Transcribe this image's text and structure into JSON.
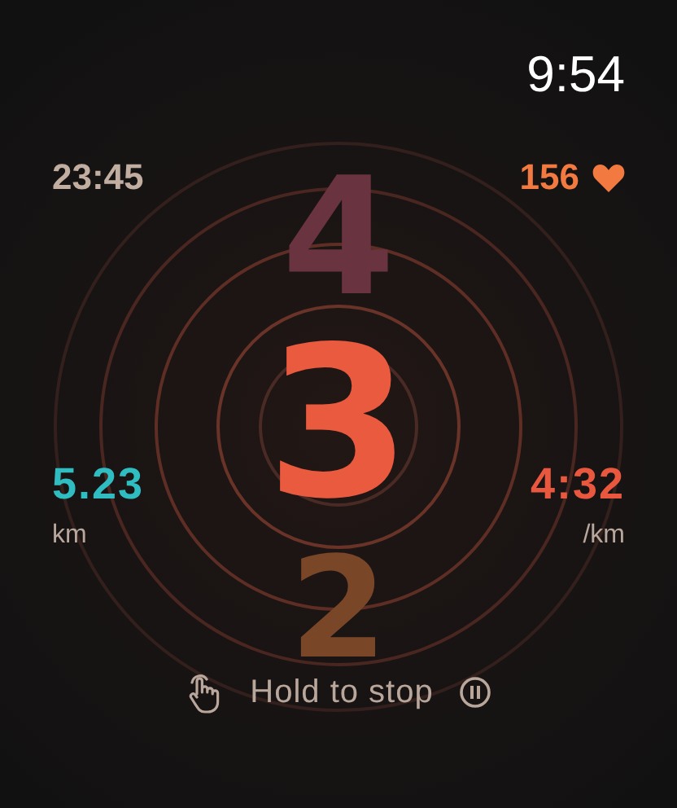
{
  "status_bar": {
    "time": "9:54"
  },
  "elapsed": "23:45",
  "heart_rate": "156",
  "countdown": {
    "previous": "4",
    "current": "3",
    "next": "2"
  },
  "distance": {
    "value": "5.23",
    "unit": "km"
  },
  "pace": {
    "value": "4:32",
    "unit": "/km"
  },
  "hint": "Hold to stop"
}
